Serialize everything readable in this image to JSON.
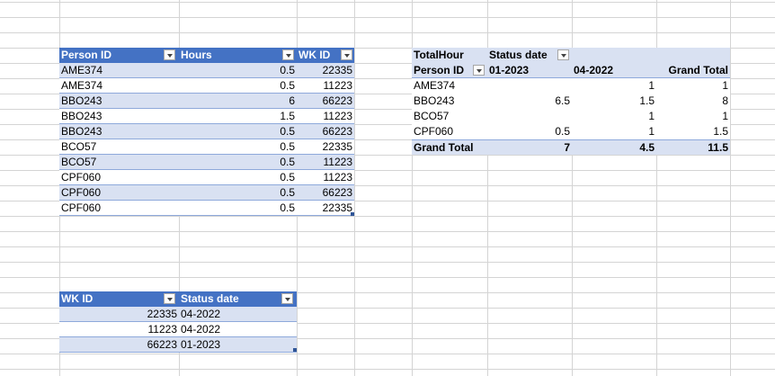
{
  "table1": {
    "headers": [
      "Person ID",
      "Hours",
      "WK ID"
    ],
    "rows": [
      [
        "AME374",
        "0.5",
        "22335"
      ],
      [
        "AME374",
        "0.5",
        "11223"
      ],
      [
        "BBO243",
        "6",
        "66223"
      ],
      [
        "BBO243",
        "1.5",
        "11223"
      ],
      [
        "BBO243",
        "0.5",
        "66223"
      ],
      [
        "BCO57",
        "0.5",
        "22335"
      ],
      [
        "BCO57",
        "0.5",
        "11223"
      ],
      [
        "CPF060",
        "0.5",
        "11223"
      ],
      [
        "CPF060",
        "0.5",
        "66223"
      ],
      [
        "CPF060",
        "0.5",
        "22335"
      ]
    ]
  },
  "table2": {
    "headers": [
      "WK ID",
      "Status date"
    ],
    "rows": [
      [
        "22335",
        "04-2022"
      ],
      [
        "11223",
        "04-2022"
      ],
      [
        "66223",
        "01-2023"
      ]
    ]
  },
  "pivot": {
    "value_label": "TotalHour",
    "column_field": "Status date",
    "row_field": "Person ID",
    "columns": [
      "01-2023",
      "04-2022",
      "Grand Total"
    ],
    "rows": [
      {
        "label": "AME374",
        "values": [
          "",
          "1",
          "1"
        ]
      },
      {
        "label": "BBO243",
        "values": [
          "6.5",
          "1.5",
          "8"
        ]
      },
      {
        "label": "BCO57",
        "values": [
          "",
          "1",
          "1"
        ]
      },
      {
        "label": "CPF060",
        "values": [
          "0.5",
          "1",
          "1.5"
        ]
      }
    ],
    "grand_total": {
      "label": "Grand Total",
      "values": [
        "7",
        "4.5",
        "11.5"
      ]
    }
  },
  "colors": {
    "header_blue": "#4472c4",
    "band_blue": "#d9e1f2",
    "gridline": "#d4d4d4"
  },
  "icons": {
    "filter": "filter-dropdown-icon"
  }
}
